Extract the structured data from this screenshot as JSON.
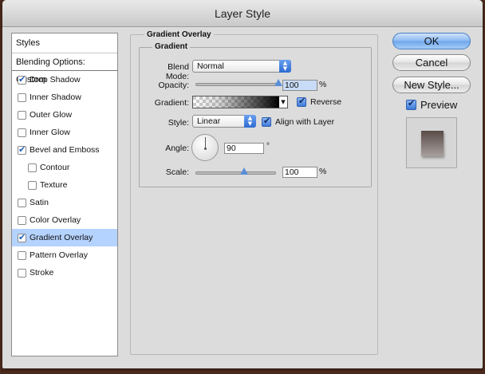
{
  "window": {
    "title": "Layer Style"
  },
  "styles_panel": {
    "header": "Styles",
    "blending_options": "Blending Options: Custom",
    "items": [
      {
        "label": "Drop Shadow",
        "checked": true,
        "indent": false,
        "selected": false
      },
      {
        "label": "Inner Shadow",
        "checked": false,
        "indent": false,
        "selected": false
      },
      {
        "label": "Outer Glow",
        "checked": false,
        "indent": false,
        "selected": false
      },
      {
        "label": "Inner Glow",
        "checked": false,
        "indent": false,
        "selected": false
      },
      {
        "label": "Bevel and Emboss",
        "checked": true,
        "indent": false,
        "selected": false
      },
      {
        "label": "Contour",
        "checked": false,
        "indent": true,
        "selected": false
      },
      {
        "label": "Texture",
        "checked": false,
        "indent": true,
        "selected": false
      },
      {
        "label": "Satin",
        "checked": false,
        "indent": false,
        "selected": false
      },
      {
        "label": "Color Overlay",
        "checked": false,
        "indent": false,
        "selected": false
      },
      {
        "label": "Gradient Overlay",
        "checked": true,
        "indent": false,
        "selected": true
      },
      {
        "label": "Pattern Overlay",
        "checked": false,
        "indent": false,
        "selected": false
      },
      {
        "label": "Stroke",
        "checked": false,
        "indent": false,
        "selected": false
      }
    ]
  },
  "gradient_overlay": {
    "group_title": "Gradient Overlay",
    "subgroup_title": "Gradient",
    "blend_mode_label": "Blend Mode:",
    "blend_mode_value": "Normal",
    "opacity_label": "Opacity:",
    "opacity_value": "100",
    "opacity_fraction": 1.0,
    "percent": "%",
    "gradient_label": "Gradient:",
    "reverse_label": "Reverse",
    "style_label": "Style:",
    "style_value": "Linear",
    "align_label": "Align with Layer",
    "angle_label": "Angle:",
    "angle_value": "90",
    "degree_symbol": "°",
    "scale_label": "Scale:",
    "scale_value": "100",
    "scale_fraction": 0.6
  },
  "buttons": {
    "ok": "OK",
    "cancel": "Cancel",
    "new_style": "New Style..."
  },
  "preview": {
    "label": "Preview",
    "checked": true
  },
  "colors": {
    "selection": "#b5d3ff",
    "accent": "#3f7ad8",
    "gradient_end": "#000000"
  }
}
